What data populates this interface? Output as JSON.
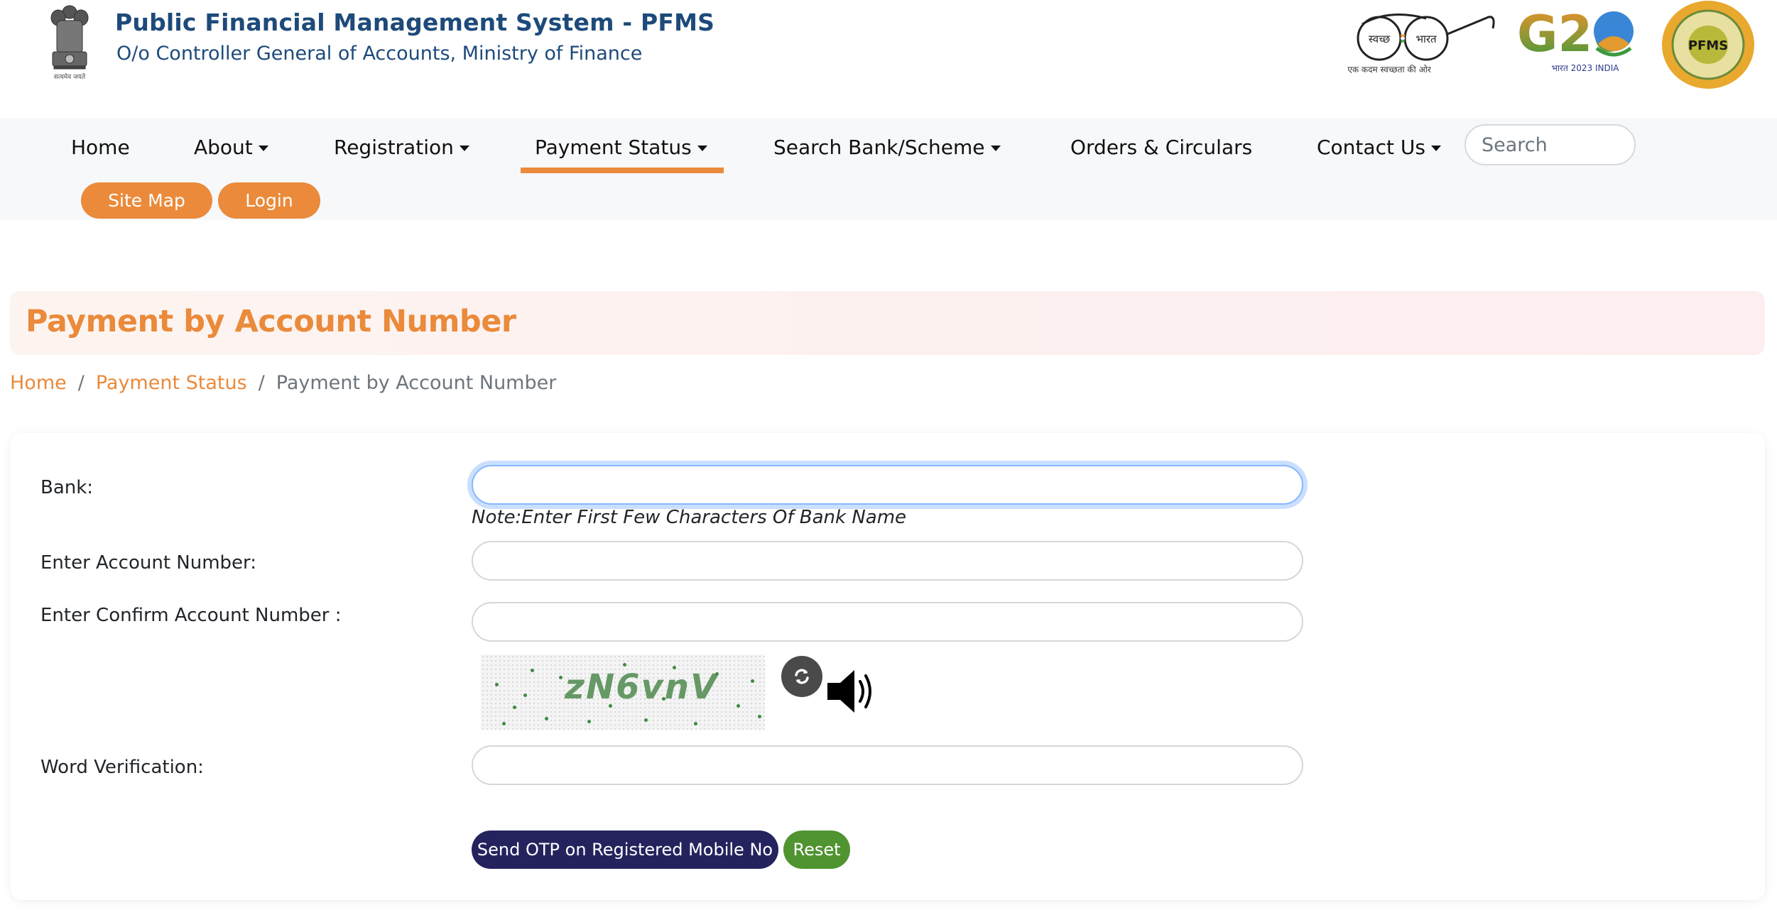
{
  "header": {
    "title": "Public Financial Management System - PFMS",
    "subtitle": "O/o Controller General of Accounts, Ministry of Finance",
    "emblem_caption": "सत्यमेव जयते",
    "logos": {
      "swachh": {
        "left_word": "स्वच्छ",
        "right_word": "भारत",
        "tagline": "एक कदम स्वच्छता की ओर"
      },
      "g20": {
        "text": "G20",
        "caption": "भारत 2023 INDIA"
      },
      "seal": {
        "text": "PFMS"
      }
    }
  },
  "nav": {
    "items": [
      {
        "label": "Home",
        "dropdown": false
      },
      {
        "label": "About",
        "dropdown": true
      },
      {
        "label": "Registration",
        "dropdown": true
      },
      {
        "label": "Payment Status",
        "dropdown": true,
        "active": true
      },
      {
        "label": "Search Bank/Scheme",
        "dropdown": true
      },
      {
        "label": "Orders & Circulars",
        "dropdown": false
      },
      {
        "label": "Contact Us",
        "dropdown": true
      }
    ],
    "search_placeholder": "Search",
    "site_map_label": "Site Map",
    "login_label": "Login"
  },
  "page": {
    "heading": "Payment by Account Number",
    "breadcrumb": [
      "Home",
      "Payment Status",
      "Payment by Account Number"
    ],
    "breadcrumb_separator": "/"
  },
  "form": {
    "bank_label": "Bank:",
    "bank_value": "",
    "bank_note": "Note:Enter First Few Characters Of Bank Name",
    "account_label": "Enter Account Number:",
    "account_value": "",
    "confirm_label": "Enter Confirm Account Number :",
    "confirm_value": "",
    "captcha_text": "zN6vnV",
    "word_label": "Word Verification:",
    "word_value": "",
    "send_otp_label": "Send OTP on Registered Mobile No",
    "reset_label": "Reset"
  },
  "colors": {
    "accent": "#ea8a3a",
    "brand_blue": "#1d4a7a",
    "otp_button": "#25235e",
    "reset_button": "#4f9430",
    "nav_bg": "#f7f8fa"
  }
}
